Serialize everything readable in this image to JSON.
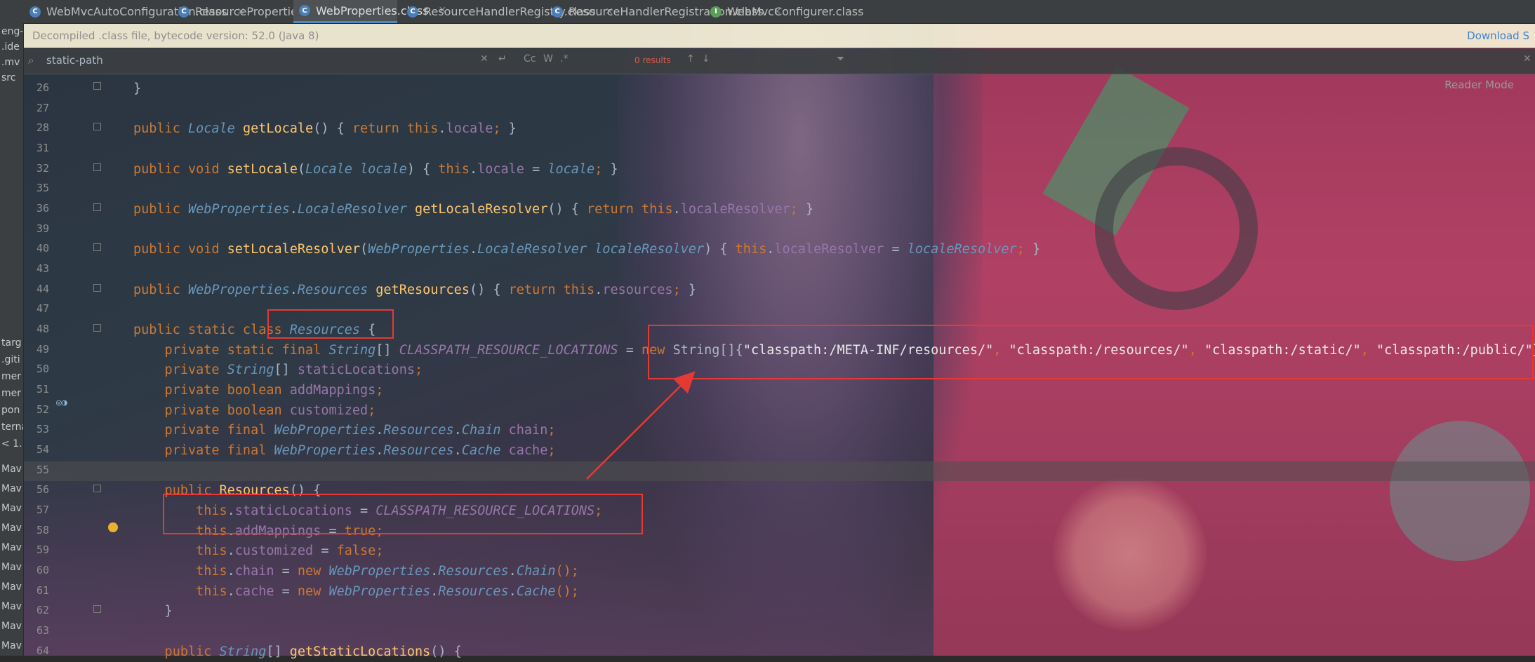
{
  "tabs": [
    {
      "label": "WebMvcAutoConfiguration.class",
      "icon": "class-icon",
      "active": false
    },
    {
      "label": "ResourceProperties.class",
      "icon": "class-icon",
      "active": false
    },
    {
      "label": "WebProperties.class",
      "icon": "class-icon",
      "active": true
    },
    {
      "label": "ResourceHandlerRegistry.class",
      "icon": "class-icon",
      "active": false
    },
    {
      "label": "ResourceHandlerRegistration.class",
      "icon": "class-icon",
      "active": false
    },
    {
      "label": "WebMvcConfigurer.class",
      "icon": "interface-icon",
      "active": false
    }
  ],
  "banner": {
    "text": "Decompiled .class file, bytecode version: 52.0 (Java 8)",
    "link": "Download S"
  },
  "search": {
    "query": "static-path",
    "results": "0 results"
  },
  "reader_mode": "Reader Mode",
  "left_panel": [
    "eng-",
    ".ide",
    ".mv",
    "src",
    "targ",
    ".giti",
    "mer",
    "mer",
    "pon",
    "terna",
    "< 1.",
    "Mav",
    "Mav",
    "Mav",
    "Mav",
    "Mav",
    "Mav",
    "Mav",
    "Mav",
    "Mav",
    "Mav",
    "Mav"
  ],
  "line_numbers": [
    "26",
    "27",
    "28",
    "31",
    "32",
    "35",
    "36",
    "39",
    "40",
    "43",
    "44",
    "47",
    "48",
    "49",
    "50",
    "51",
    "52",
    "53",
    "54",
    "55",
    "56",
    "57",
    "58",
    "59",
    "60",
    "61",
    "62",
    "63",
    "64"
  ],
  "code": {
    "l26": "}",
    "l28": [
      {
        "t": "public ",
        "c": "kw"
      },
      {
        "t": "Locale ",
        "c": "ty"
      },
      {
        "t": "getLocale",
        "c": "mt"
      },
      {
        "t": "() { ",
        "c": "gr"
      },
      {
        "t": "return this",
        "c": "kw"
      },
      {
        "t": ".",
        "c": "gr"
      },
      {
        "t": "locale",
        "c": "fld"
      },
      {
        "t": "; ",
        "c": "pn"
      },
      {
        "t": "}",
        "c": "gr"
      }
    ],
    "l32": [
      {
        "t": "public void ",
        "c": "kw"
      },
      {
        "t": "setLocale",
        "c": "mt"
      },
      {
        "t": "(",
        "c": "gr"
      },
      {
        "t": "Locale locale",
        "c": "ty"
      },
      {
        "t": ") { ",
        "c": "gr"
      },
      {
        "t": "this",
        "c": "kw"
      },
      {
        "t": ".",
        "c": "gr"
      },
      {
        "t": "locale",
        "c": "fld"
      },
      {
        "t": " = ",
        "c": "gr"
      },
      {
        "t": "locale",
        "c": "ty"
      },
      {
        "t": "; ",
        "c": "pn"
      },
      {
        "t": "}",
        "c": "gr"
      }
    ],
    "l36": [
      {
        "t": "public ",
        "c": "kw"
      },
      {
        "t": "WebProperties",
        "c": "ty"
      },
      {
        "t": ".",
        "c": "gr"
      },
      {
        "t": "LocaleResolver ",
        "c": "ty"
      },
      {
        "t": "getLocaleResolver",
        "c": "mt"
      },
      {
        "t": "() { ",
        "c": "gr"
      },
      {
        "t": "return this",
        "c": "kw"
      },
      {
        "t": ".",
        "c": "gr"
      },
      {
        "t": "localeResolver",
        "c": "fld"
      },
      {
        "t": "; ",
        "c": "pn"
      },
      {
        "t": "}",
        "c": "gr"
      }
    ],
    "l40": [
      {
        "t": "public void ",
        "c": "kw"
      },
      {
        "t": "setLocaleResolver",
        "c": "mt"
      },
      {
        "t": "(",
        "c": "gr"
      },
      {
        "t": "WebProperties",
        "c": "ty"
      },
      {
        "t": ".",
        "c": "gr"
      },
      {
        "t": "LocaleResolver localeResolver",
        "c": "ty"
      },
      {
        "t": ") { ",
        "c": "gr"
      },
      {
        "t": "this",
        "c": "kw"
      },
      {
        "t": ".",
        "c": "gr"
      },
      {
        "t": "localeResolver",
        "c": "fld"
      },
      {
        "t": " = ",
        "c": "gr"
      },
      {
        "t": "localeResolver",
        "c": "ty"
      },
      {
        "t": "; ",
        "c": "pn"
      },
      {
        "t": "}",
        "c": "gr"
      }
    ],
    "l44": [
      {
        "t": "public ",
        "c": "kw"
      },
      {
        "t": "WebProperties",
        "c": "ty"
      },
      {
        "t": ".",
        "c": "gr"
      },
      {
        "t": "Resources ",
        "c": "ty"
      },
      {
        "t": "getResources",
        "c": "mt"
      },
      {
        "t": "() { ",
        "c": "gr"
      },
      {
        "t": "return this",
        "c": "kw"
      },
      {
        "t": ".",
        "c": "gr"
      },
      {
        "t": "resources",
        "c": "fld"
      },
      {
        "t": "; ",
        "c": "pn"
      },
      {
        "t": "}",
        "c": "gr"
      }
    ],
    "l48": [
      {
        "t": "public static class ",
        "c": "kw"
      },
      {
        "t": "Resources ",
        "c": "ty"
      },
      {
        "t": "{",
        "c": "gr"
      }
    ],
    "l49": [
      {
        "t": "    private static final ",
        "c": "kw"
      },
      {
        "t": "String",
        "c": "ty"
      },
      {
        "t": "[] ",
        "c": "gr"
      },
      {
        "t": "CLASSPATH_RESOURCE_LOCATIONS",
        "c": "cst"
      },
      {
        "t": " = ",
        "c": "gr"
      },
      {
        "t": "new ",
        "c": "kw"
      },
      {
        "t": "String",
        "c": "tyn"
      },
      {
        "t": "[]{",
        "c": "gr"
      },
      {
        "t": "\"classpath:/META-INF/resources/\"",
        "c": "str"
      },
      {
        "t": ", ",
        "c": "pn"
      },
      {
        "t": "\"classpath:/resources/\"",
        "c": "str"
      },
      {
        "t": ", ",
        "c": "pn"
      },
      {
        "t": "\"classpath:/static/\"",
        "c": "str"
      },
      {
        "t": ", ",
        "c": "pn"
      },
      {
        "t": "\"classpath:/public/\"",
        "c": "str"
      },
      {
        "t": "};",
        "c": "br"
      }
    ],
    "l50": [
      {
        "t": "    private ",
        "c": "kw"
      },
      {
        "t": "String",
        "c": "ty"
      },
      {
        "t": "[] ",
        "c": "gr"
      },
      {
        "t": "staticLocations",
        "c": "fld"
      },
      {
        "t": ";",
        "c": "pn"
      }
    ],
    "l51": [
      {
        "t": "    private boolean ",
        "c": "kw"
      },
      {
        "t": "addMappings",
        "c": "fld"
      },
      {
        "t": ";",
        "c": "pn"
      }
    ],
    "l52": [
      {
        "t": "    private boolean ",
        "c": "kw"
      },
      {
        "t": "customized",
        "c": "fld"
      },
      {
        "t": ";",
        "c": "pn"
      }
    ],
    "l53": [
      {
        "t": "    private final ",
        "c": "kw"
      },
      {
        "t": "WebProperties",
        "c": "ty"
      },
      {
        "t": ".",
        "c": "gr"
      },
      {
        "t": "Resources",
        "c": "ty"
      },
      {
        "t": ".",
        "c": "gr"
      },
      {
        "t": "Chain ",
        "c": "ty"
      },
      {
        "t": "chain",
        "c": "fld"
      },
      {
        "t": ";",
        "c": "pn"
      }
    ],
    "l54": [
      {
        "t": "    private final ",
        "c": "kw"
      },
      {
        "t": "WebProperties",
        "c": "ty"
      },
      {
        "t": ".",
        "c": "gr"
      },
      {
        "t": "Resources",
        "c": "ty"
      },
      {
        "t": ".",
        "c": "gr"
      },
      {
        "t": "Cache ",
        "c": "ty"
      },
      {
        "t": "cache",
        "c": "fld"
      },
      {
        "t": ";",
        "c": "pn"
      }
    ],
    "l56": [
      {
        "t": "    public ",
        "c": "kw"
      },
      {
        "t": "Resources",
        "c": "mt"
      },
      {
        "t": "() {",
        "c": "gr"
      }
    ],
    "l57": [
      {
        "t": "        this",
        "c": "kw"
      },
      {
        "t": ".",
        "c": "gr"
      },
      {
        "t": "staticLocations",
        "c": "fld"
      },
      {
        "t": " = ",
        "c": "gr"
      },
      {
        "t": "CLASSPATH_RESOURCE_LOCATIONS",
        "c": "cst"
      },
      {
        "t": ";",
        "c": "pn"
      }
    ],
    "l58": [
      {
        "t": "        this",
        "c": "kw"
      },
      {
        "t": ".",
        "c": "gr"
      },
      {
        "t": "addMappings",
        "c": "fld"
      },
      {
        "t": " = ",
        "c": "gr"
      },
      {
        "t": "true",
        "c": "kw"
      },
      {
        "t": ";",
        "c": "pn"
      }
    ],
    "l59": [
      {
        "t": "        this",
        "c": "kw"
      },
      {
        "t": ".",
        "c": "gr"
      },
      {
        "t": "customized",
        "c": "fld"
      },
      {
        "t": " = ",
        "c": "gr"
      },
      {
        "t": "false",
        "c": "kw"
      },
      {
        "t": ";",
        "c": "pn"
      }
    ],
    "l60": [
      {
        "t": "        this",
        "c": "kw"
      },
      {
        "t": ".",
        "c": "gr"
      },
      {
        "t": "chain",
        "c": "fld"
      },
      {
        "t": " = ",
        "c": "gr"
      },
      {
        "t": "new ",
        "c": "kw"
      },
      {
        "t": "WebProperties",
        "c": "ty"
      },
      {
        "t": ".",
        "c": "gr"
      },
      {
        "t": "Resources",
        "c": "ty"
      },
      {
        "t": ".",
        "c": "gr"
      },
      {
        "t": "Chain",
        "c": "ty"
      },
      {
        "t": "();",
        "c": "pn"
      }
    ],
    "l61": [
      {
        "t": "        this",
        "c": "kw"
      },
      {
        "t": ".",
        "c": "gr"
      },
      {
        "t": "cache",
        "c": "fld"
      },
      {
        "t": " = ",
        "c": "gr"
      },
      {
        "t": "new ",
        "c": "kw"
      },
      {
        "t": "WebProperties",
        "c": "ty"
      },
      {
        "t": ".",
        "c": "gr"
      },
      {
        "t": "Resources",
        "c": "ty"
      },
      {
        "t": ".",
        "c": "gr"
      },
      {
        "t": "Cache",
        "c": "ty"
      },
      {
        "t": "();",
        "c": "pn"
      }
    ],
    "l62": "    }",
    "l64": [
      {
        "t": "    public ",
        "c": "kw"
      },
      {
        "t": "String",
        "c": "ty"
      },
      {
        "t": "[] ",
        "c": "gr"
      },
      {
        "t": "getStaticLocations",
        "c": "mt"
      },
      {
        "t": "() {",
        "c": "gr"
      }
    ]
  },
  "colors": {
    "annotation": "#e53935",
    "accent": "#4a88c7"
  }
}
